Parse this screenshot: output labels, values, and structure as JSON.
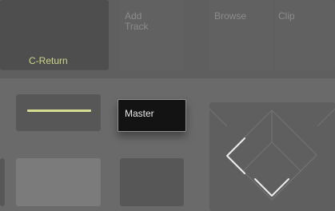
{
  "pads": {
    "return_label": "C-Return",
    "add_track_label": "Add\nTrack",
    "browse_label": "Browse",
    "clip_label": "Clip",
    "master_label": "Master"
  },
  "icons": {
    "left": "chevron-left-icon",
    "down": "chevron-down-icon"
  },
  "colors": {
    "return_accent": "#d6dc92",
    "master_bg": "#131313"
  }
}
